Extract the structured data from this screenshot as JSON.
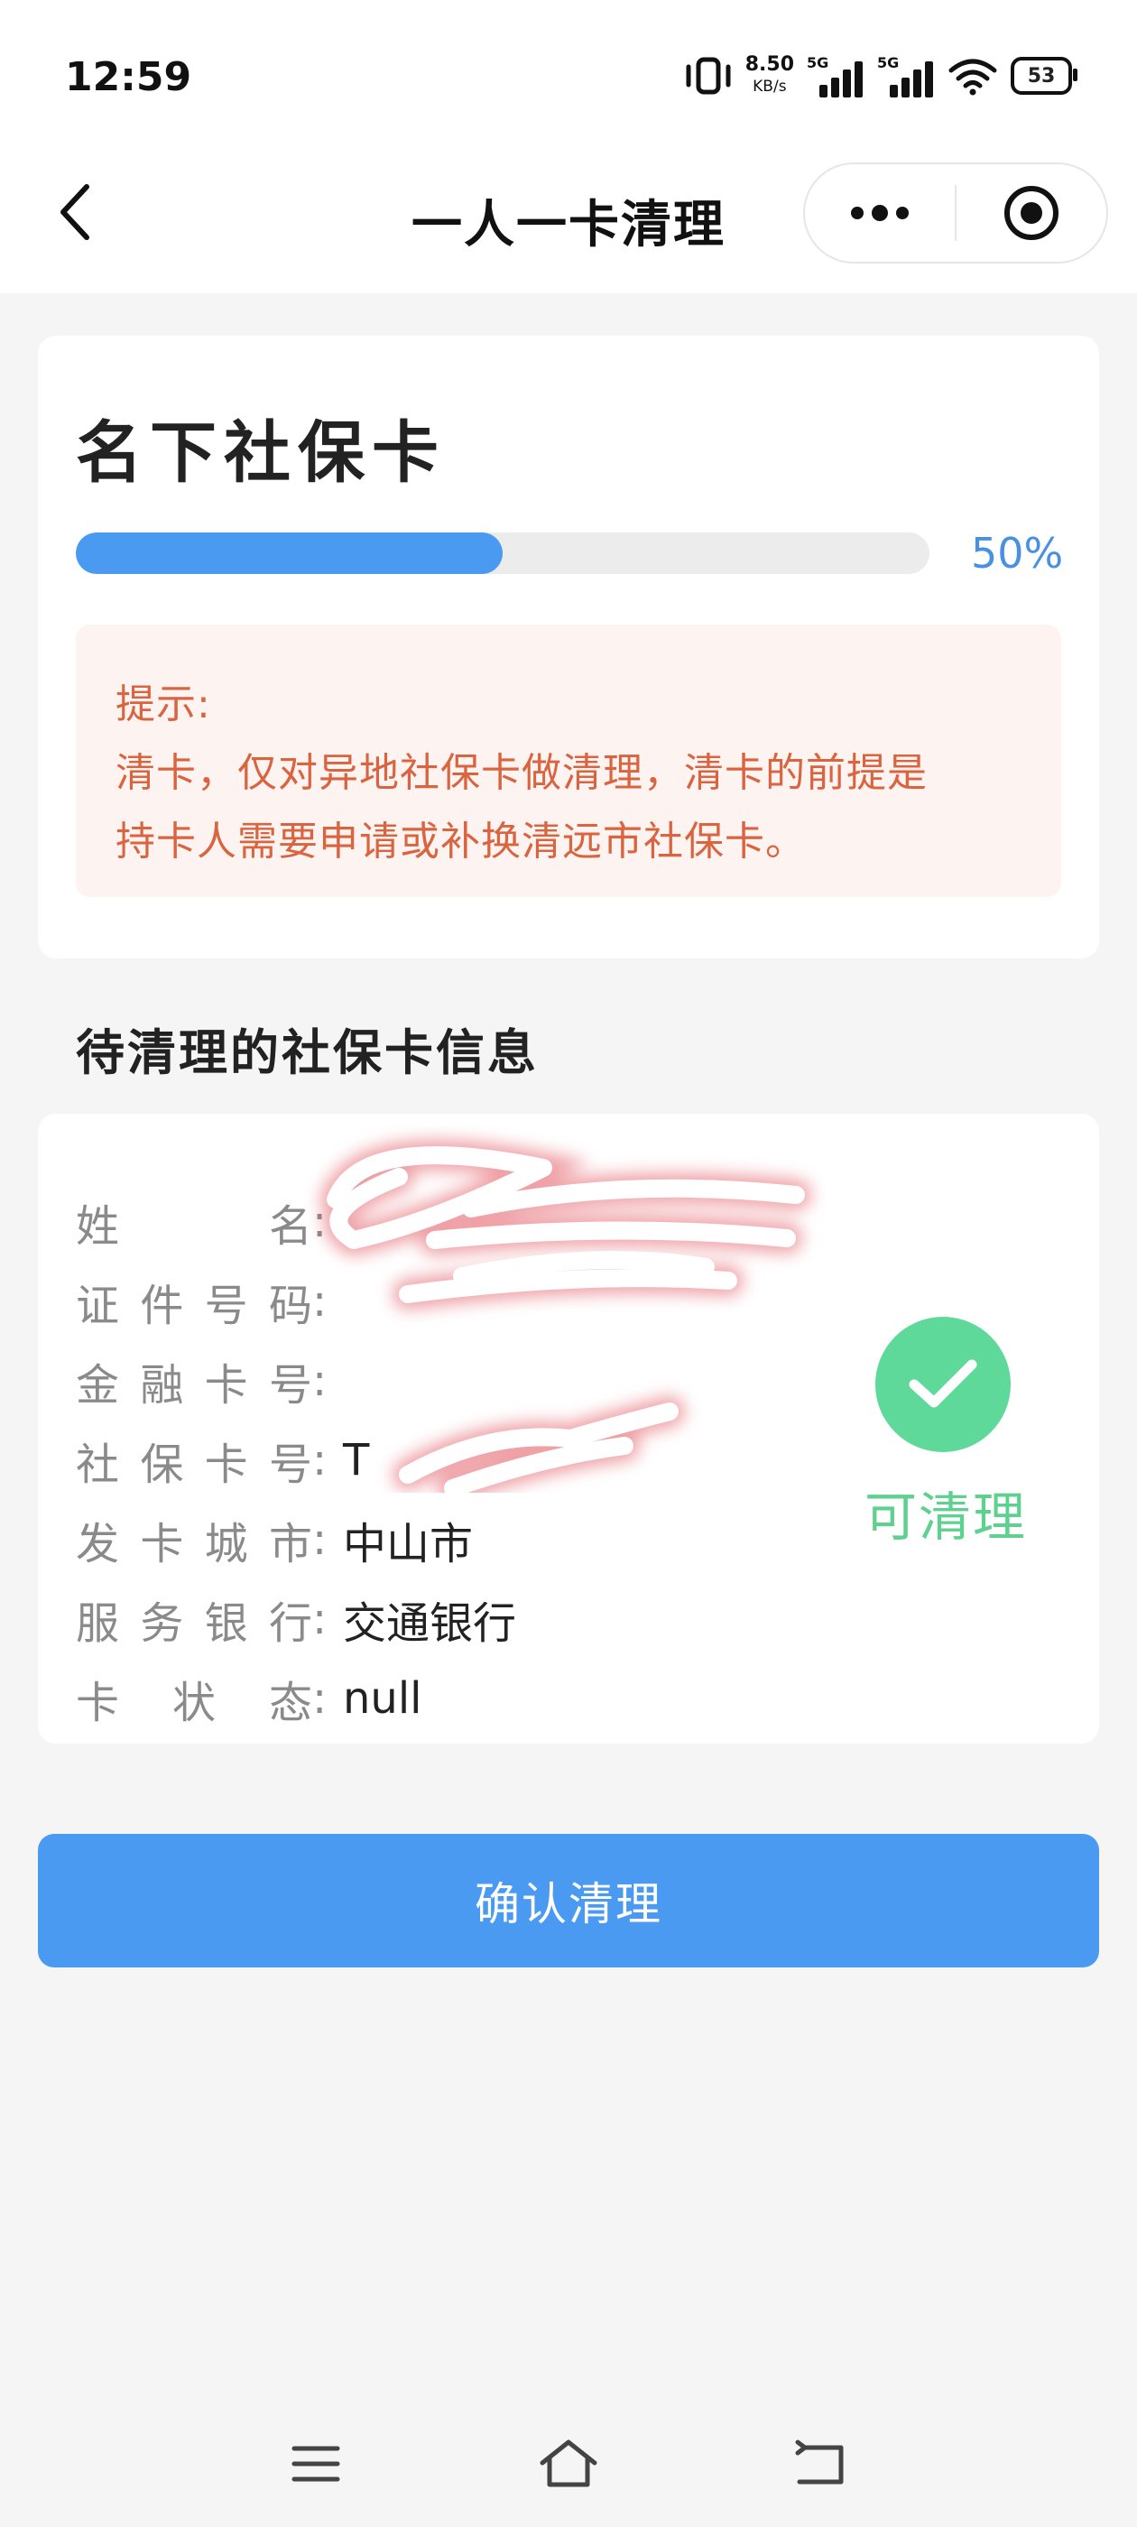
{
  "status_bar": {
    "time": "12:59",
    "net_speed": "8.50",
    "net_unit": "KB/s",
    "signal_tag_1": "5G",
    "signal_tag_2": "5G",
    "battery": "53"
  },
  "nav": {
    "title": "一人一卡清理"
  },
  "summary_card": {
    "title": "名下社保卡",
    "progress_fraction": 0.5,
    "progress_text": "50%",
    "tip_label": "提示:",
    "tip_line_1": "清卡，仅对异地社保卡做清理，清卡的前提是",
    "tip_line_2": "持卡人需要申请或补换清远市社保卡。"
  },
  "section_title": "待清理的社保卡信息",
  "card_info": {
    "rows": [
      {
        "label_chars": [
          "姓",
          "名"
        ],
        "value": ""
      },
      {
        "label_chars": [
          "证",
          "件",
          "号",
          "码"
        ],
        "value": ""
      },
      {
        "label_chars": [
          "金",
          "融",
          "卡",
          "号"
        ],
        "value": ""
      },
      {
        "label_chars": [
          "社",
          "保",
          "卡",
          "号"
        ],
        "value": "T"
      },
      {
        "label_chars": [
          "发",
          "卡",
          "城",
          "市"
        ],
        "value": "中山市"
      },
      {
        "label_chars": [
          "服",
          "务",
          "银",
          "行"
        ],
        "value": "交通银行"
      },
      {
        "label_chars": [
          "卡",
          "状",
          "态"
        ],
        "value": "null"
      }
    ],
    "status_text": "可清理",
    "status_color": "#5fd18f"
  },
  "actions": {
    "confirm_label": "确认清理"
  },
  "colors": {
    "primary": "#4a9af2",
    "tip_text": "#d9643f",
    "tip_bg": "#fdf3f1"
  }
}
